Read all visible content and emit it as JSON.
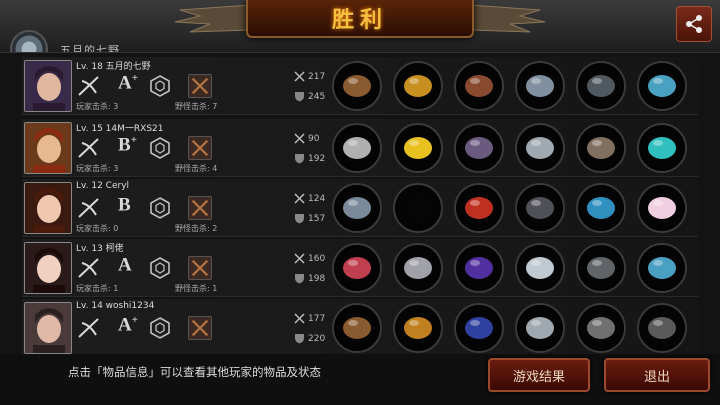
{
  "header": {
    "title": "胜利",
    "behind_text": "五月的七野"
  },
  "players": [
    {
      "level_name": "Lv. 18 五月的七野",
      "grade": "A",
      "grade_plus": "+",
      "player_kills": "玩家击杀: 3",
      "monster_kills": "野怪击杀: 7",
      "attack": "217",
      "defense": "245",
      "weapon_icon": "crossbow-icon",
      "items": [
        "crossbow-item-icon",
        "crown-item-icon",
        "gauntlet-item-icon",
        "ring-item-icon",
        "boots-item-icon",
        "amulet-item-icon"
      ]
    },
    {
      "level_name": "Lv. 15 14M一RXS21",
      "grade": "B",
      "grade_plus": "+",
      "player_kills": "玩家击杀: 3",
      "monster_kills": "野怪击杀: 4",
      "attack": "90",
      "defense": "192",
      "weapon_icon": "daggers-icon",
      "items": [
        "daggers-item-icon",
        "hardhat-item-icon",
        "armor-item-icon",
        "disc-item-icon",
        "shoes-item-icon",
        "eye-gem-item-icon"
      ]
    },
    {
      "level_name": "Lv. 12 Ceryl",
      "grade": "B",
      "grade_plus": "",
      "player_kills": "玩家击杀: 0",
      "monster_kills": "野怪击杀: 2",
      "attack": "124",
      "defense": "157",
      "weapon_icon": "sword-icon",
      "items": [
        "sword-item-icon",
        "empty-slot",
        "red-armor-item-icon",
        "dark-helmet-item-icon",
        "blue-boots-item-icon",
        "pearl-item-icon"
      ]
    },
    {
      "level_name": "Lv. 13 柯佬",
      "grade": "A",
      "grade_plus": "",
      "player_kills": "玩家击杀: 1",
      "monster_kills": "野怪击杀: 1",
      "attack": "160",
      "defense": "198",
      "weapon_icon": "sword-icon",
      "items": [
        "blade-item-icon",
        "knight-helmet-item-icon",
        "purple-armor-item-icon",
        "silver-blade-item-icon",
        "grey-boots-item-icon",
        "amulet-item-icon"
      ]
    },
    {
      "level_name": "Lv. 14 woshi1234",
      "grade": "A",
      "grade_plus": "+",
      "player_kills": "",
      "monster_kills": "",
      "attack": "177",
      "defense": "220",
      "weapon_icon": "crossbow-icon",
      "items": [
        "crossbow-item-icon",
        "gold-helmet-item-icon",
        "blue-armor-item-icon",
        "disc-item-icon",
        "claw-item-icon",
        "chest-item-icon"
      ]
    }
  ],
  "footer": {
    "hint": "点击「物品信息」可以查看其他玩家的物品及状态",
    "result_button": "游戏结果",
    "exit_button": "退出"
  },
  "colors": {
    "gold": "#f5c040",
    "grade_text": "#d8d8d8",
    "button_bg": "#6a1c10"
  }
}
